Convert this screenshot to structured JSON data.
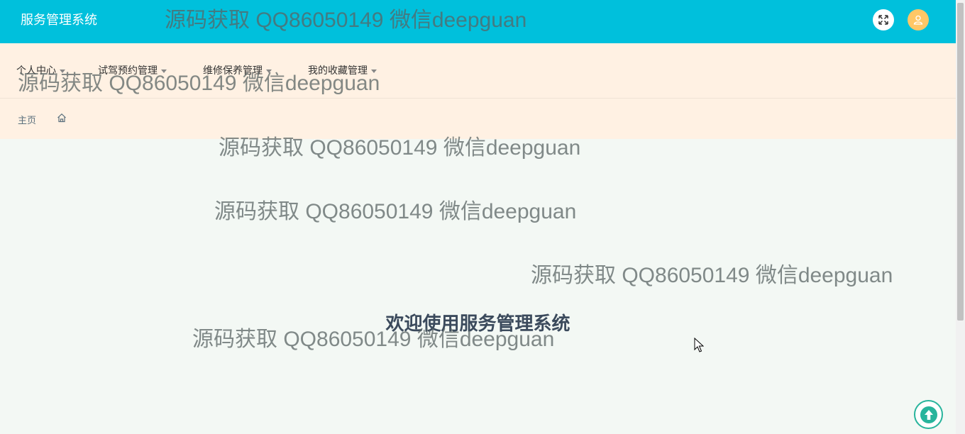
{
  "header": {
    "app_title": "服务管理系统",
    "fullscreen_icon": "fullscreen-icon",
    "avatar_icon": "user-icon"
  },
  "menu": {
    "items": [
      {
        "label": "个人中心"
      },
      {
        "label": "试驾预约管理"
      },
      {
        "label": "维修保养管理"
      },
      {
        "label": "我的收藏管理"
      }
    ]
  },
  "breadcrumb": {
    "home_label": "主页",
    "home_icon": "home-icon"
  },
  "main": {
    "welcome_text": "欢迎使用服务管理系统"
  },
  "watermark": {
    "text": "源码获取 QQ86050149 微信deepguan"
  },
  "colors": {
    "header_bg": "#00c0dc",
    "menu_bg": "#fff1e3",
    "page_bg": "#f3f8f4",
    "avatar_bg": "#ffc766",
    "accent": "#28b49c"
  }
}
